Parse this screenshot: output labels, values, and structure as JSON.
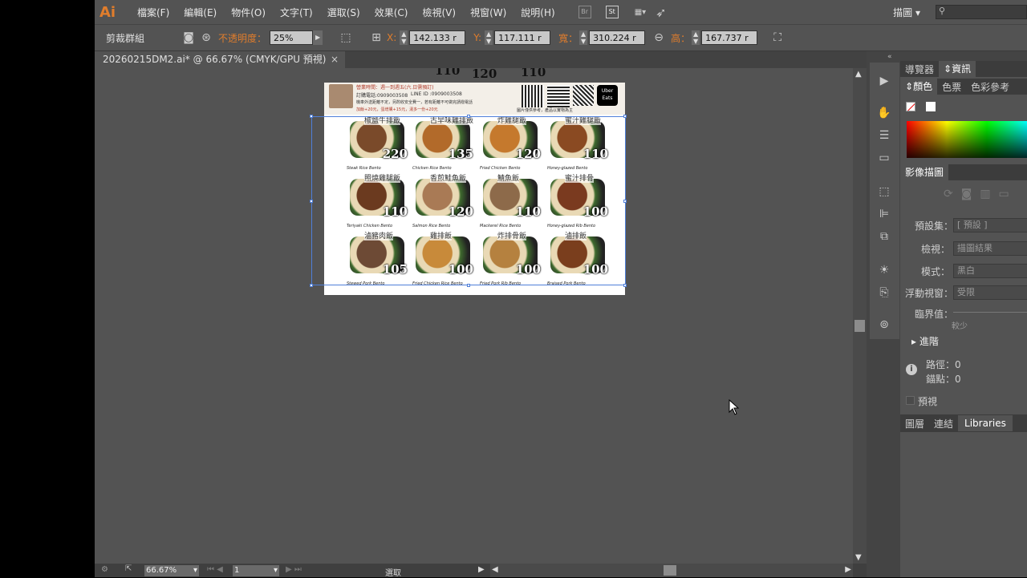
{
  "menubar": {
    "logo": "Ai",
    "items": [
      "檔案(F)",
      "編輯(E)",
      "物件(O)",
      "文字(T)",
      "選取(S)",
      "效果(C)",
      "檢視(V)",
      "視窗(W)",
      "說明(H)"
    ],
    "br": "Br",
    "st": "St",
    "workspace": "描圖",
    "search_placeholder": ""
  },
  "control": {
    "group_label": "剪裁群組",
    "opacity_label": "不透明度：",
    "opacity_value": "25%",
    "x_label": "X:",
    "x_value": "142.133 r",
    "y_label": "Y:",
    "y_value": "117.111 r",
    "w_label": "寬：",
    "w_value": "310.224 r",
    "h_label": "高：",
    "h_value": "167.737 r"
  },
  "document": {
    "tab_title": "20260215DM2.ai* @ 66.67% (CMYK/GPU 預視)",
    "close": "×"
  },
  "artboard": {
    "top_numbers": [
      "110",
      "120",
      "110"
    ],
    "header_lines": [
      "營業時間：週一到週五(六.日需預訂)",
      "訂購電話:0909003508",
      "LINE ID :0909003508",
      "機車外送距離不定，另酌收安全費一，若有距離不可做完請撥電話",
      "加飯+20元，蛋增購+15元，湯多一份+20元"
    ],
    "uber_label": "Uber Eats",
    "note": "圖片僅供參考，產品以實物為主",
    "items": [
      {
        "name": "椒鹽牛排飯",
        "price": "220",
        "caption": "Steak Rice Bento",
        "color": "#7a4a2a"
      },
      {
        "name": "古早味雞排飯",
        "price": "135",
        "caption": "Chicken Rice Bento",
        "color": "#b26a2a"
      },
      {
        "name": "炸雞腿飯",
        "price": "120",
        "caption": "Fried Chicken Bento",
        "color": "#c5792d"
      },
      {
        "name": "蜜汁雞腿飯",
        "price": "110",
        "caption": "Honey-glazed Bento",
        "color": "#8a4a22"
      },
      {
        "name": "照燒雞腿飯",
        "price": "110",
        "caption": "Teriyaki Chicken Bento",
        "color": "#6b3a1f"
      },
      {
        "name": "香煎鮭魚飯",
        "price": "120",
        "caption": "Salmon Rice Bento",
        "color": "#a97a55"
      },
      {
        "name": "鯖魚飯",
        "price": "110",
        "caption": "Mackerel Rice Bento",
        "color": "#8d6a4a"
      },
      {
        "name": "蜜汁排骨",
        "price": "100",
        "caption": "Honey-glazed Rib Bento",
        "color": "#7a3a1f"
      },
      {
        "name": "滷豬肉飯",
        "price": "105",
        "caption": "Stewed Pork Bento",
        "color": "#6d4a35"
      },
      {
        "name": "雞排飯",
        "price": "100",
        "caption": "Fried Chicken Rice Bento",
        "color": "#c88a3a"
      },
      {
        "name": "炸排骨飯",
        "price": "100",
        "caption": "Fried Pork Rib Bento",
        "color": "#b5813f"
      },
      {
        "name": "滷排飯",
        "price": "100",
        "caption": "Braised Pork Bento",
        "color": "#7a3e1d"
      }
    ]
  },
  "status": {
    "zoom": "66.67%",
    "page": "1",
    "tool": "選取"
  },
  "panels": {
    "top_tabs": [
      "導覽器",
      "資訊"
    ],
    "color_tabs": [
      "顏色",
      "色票",
      "色彩參考"
    ],
    "trace_title": "影像描圖",
    "preset_label": "預設集：",
    "preset_value": "[ 預設 ]",
    "view_label": "檢視：",
    "view_value": "描圖結果",
    "mode_label": "模式：",
    "mode_value": "黑白",
    "palette_label": "浮動視窗：",
    "palette_value": "受限",
    "threshold_label": "臨界值：",
    "threshold_hint": "較少",
    "advanced_label": "進階",
    "paths_label": "路徑：0",
    "anchors_label": "錨點：0",
    "preview_label": "預視",
    "bottom_tabs": [
      "圖層",
      "連結",
      "Libraries"
    ]
  }
}
